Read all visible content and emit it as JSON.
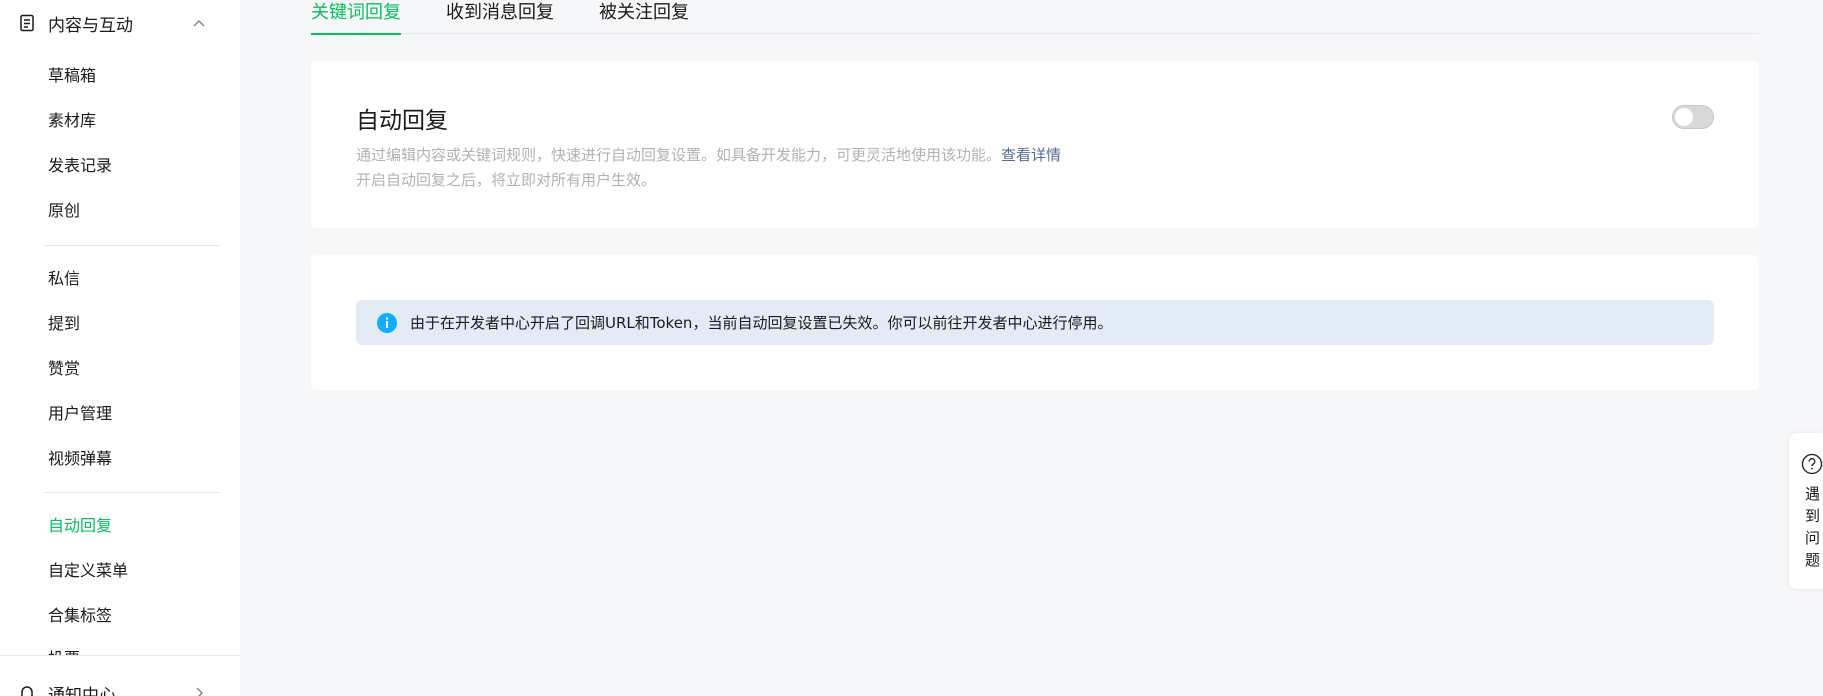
{
  "sidebar": {
    "group_title": "内容与互动",
    "items": [
      {
        "label": "草稿箱"
      },
      {
        "label": "素材库"
      },
      {
        "label": "发表记录"
      },
      {
        "label": "原创"
      },
      {
        "label": "私信"
      },
      {
        "label": "提到"
      },
      {
        "label": "赞赏"
      },
      {
        "label": "用户管理"
      },
      {
        "label": "视频弹幕"
      },
      {
        "label": "自动回复"
      },
      {
        "label": "自定义菜单"
      },
      {
        "label": "合集标签"
      },
      {
        "label": "投票"
      }
    ],
    "notify_label": "通知中心"
  },
  "tabs": [
    {
      "label": "关键词回复"
    },
    {
      "label": "收到消息回复"
    },
    {
      "label": "被关注回复"
    }
  ],
  "auto_reply": {
    "title": "自动回复",
    "desc_line1": "通过编辑内容或关键词规则，快速进行自动回复设置。如具备开发能力，可更灵活地使用该功能。",
    "detail_link": "查看详情",
    "desc_line2": "开启自动回复之后，将立即对所有用户生效。"
  },
  "notice": {
    "text": "由于在开发者中心开启了回调URL和Token，当前自动回复设置已失效。你可以前往开发者中心进行停用。"
  },
  "help": {
    "chars": [
      "遇",
      "到",
      "问",
      "题"
    ]
  },
  "colors": {
    "accent": "#07c160",
    "link": "#576b95",
    "notice_bg": "#e3ebf5",
    "info_icon": "#10aeff"
  }
}
